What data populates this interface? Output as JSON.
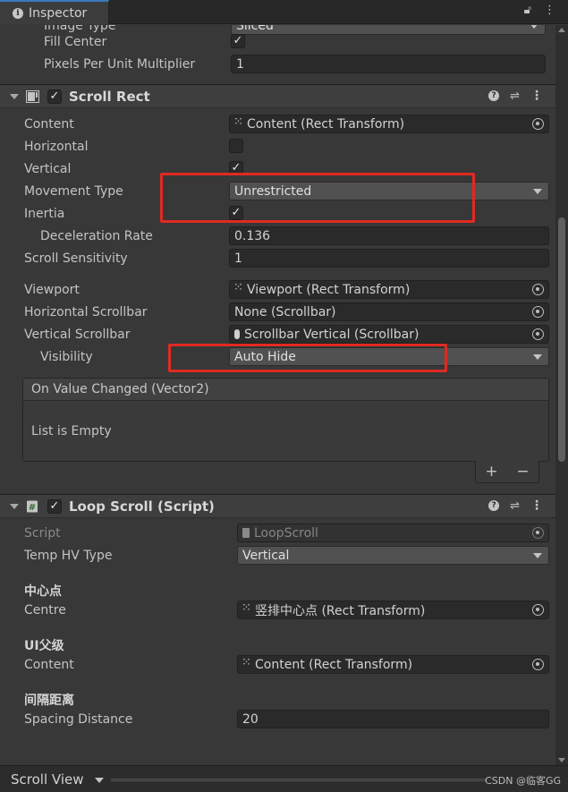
{
  "tab": {
    "title": "Inspector"
  },
  "image_section": {
    "partial_label": "Image Type",
    "partial_value": "Sliced",
    "fill_center_label": "Fill Center",
    "fill_center_checked": "✓",
    "ppu_label": "Pixels Per Unit Multiplier",
    "ppu_value": "1"
  },
  "scroll_rect": {
    "title": "Scroll Rect",
    "enabled": "✓",
    "content_label": "Content",
    "content_value": "Content (Rect Transform)",
    "horizontal_label": "Horizontal",
    "horizontal_checked": "",
    "vertical_label": "Vertical",
    "vertical_checked": "✓",
    "movement_label": "Movement Type",
    "movement_value": "Unrestricted",
    "inertia_label": "Inertia",
    "inertia_checked": "✓",
    "decel_label": "Deceleration Rate",
    "decel_value": "0.136",
    "sensitivity_label": "Scroll Sensitivity",
    "sensitivity_value": "1",
    "viewport_label": "Viewport",
    "viewport_value": "Viewport (Rect Transform)",
    "hscroll_label": "Horizontal Scrollbar",
    "hscroll_value": "None (Scrollbar)",
    "vscroll_label": "Vertical Scrollbar",
    "vscroll_value": "Scrollbar Vertical (Scrollbar)",
    "visibility_label": "Visibility",
    "visibility_value": "Auto Hide",
    "event_title": "On Value Changed (Vector2)",
    "event_empty": "List is Empty",
    "add_symbol": "+",
    "remove_symbol": "−"
  },
  "loop_scroll": {
    "title": "Loop Scroll (Script)",
    "enabled": "✓",
    "script_label": "Script",
    "script_value": "LoopScroll",
    "temp_label": "Temp HV Type",
    "temp_value": "Vertical",
    "section1": "中心点",
    "centre_label": "Centre",
    "centre_value": "竖排中心点 (Rect Transform)",
    "section2": "UI父级",
    "content_label": "Content",
    "content_value": "Content (Rect Transform)",
    "section3": "间隔距离",
    "spacing_label": "Spacing Distance",
    "spacing_value": "20"
  },
  "bottom": {
    "selector": "Scroll View",
    "watermark": "CSDN @临客GG"
  },
  "colors": {
    "highlight_box": "#e02a22",
    "accent_tab": "#3a79bb"
  }
}
